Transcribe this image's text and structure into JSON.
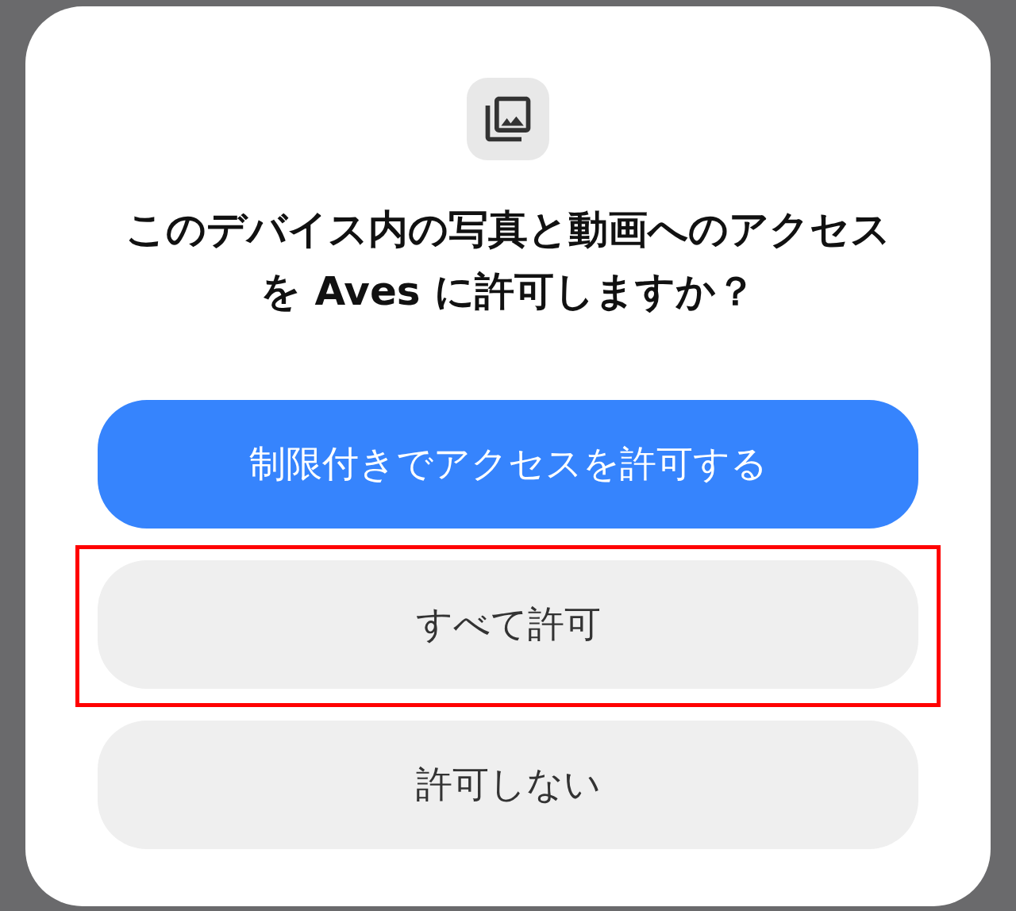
{
  "dialog": {
    "title": "このデバイス内の写真と動画へのアクセスを Aves に許可しますか？",
    "buttons": [
      {
        "label": "制限付きでアクセスを許可する",
        "kind": "primary",
        "highlighted": false
      },
      {
        "label": "すべて許可",
        "kind": "secondary",
        "highlighted": true
      },
      {
        "label": "許可しない",
        "kind": "secondary",
        "highlighted": false
      }
    ]
  }
}
